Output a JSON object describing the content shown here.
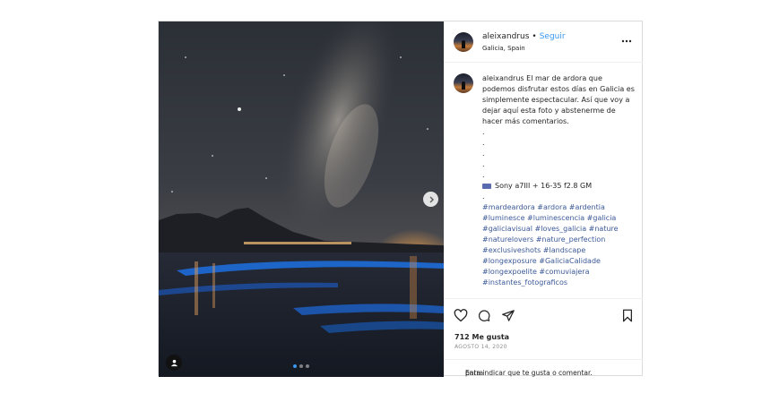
{
  "post": {
    "username": "aleixandrus",
    "separator": "•",
    "follow_label": "Seguir",
    "location": "Galicia, Spain",
    "more_icon": "more-horizontal-icon",
    "carousel_total": 3,
    "carousel_active": 1
  },
  "caption": {
    "username": "aleixandrus",
    "body": "El mar de ardora que podemos disfrutar estos días en Galicia es simplemente espectacular. Así que voy a dejar aquí esta foto y abstenerme de hacer más comentarios.",
    "dots": [
      ".",
      ".",
      ".",
      ".",
      "."
    ],
    "gear": "Sony a7III + 16-35 f2.8 GM",
    "gear_dot": ".",
    "hashtags": "#mardeardora #ardora #ardentia #luminesce #luminescencia #galicia #galiciavisual #loves_galicia #nature #naturelovers #nature_perfection #exclusiveshots #landscape #longexposure #GaliciaCalidade #longexpoelite #comuviajera #instantes_fotograficos"
  },
  "actions": {
    "like_icon": "heart-icon",
    "comment_icon": "comment-icon",
    "share_icon": "send-icon",
    "save_icon": "bookmark-icon"
  },
  "likes": "712 Me gusta",
  "date": "AGOSTO 14, 2020",
  "add_comment": {
    "login": "Entra",
    "rest": "para indicar que te gusta o comentar."
  },
  "colors": {
    "link": "#3897f0",
    "hashtag": "#3b5998",
    "border": "#dbdbdb",
    "text": "#262626",
    "muted": "#8e8e8e"
  }
}
